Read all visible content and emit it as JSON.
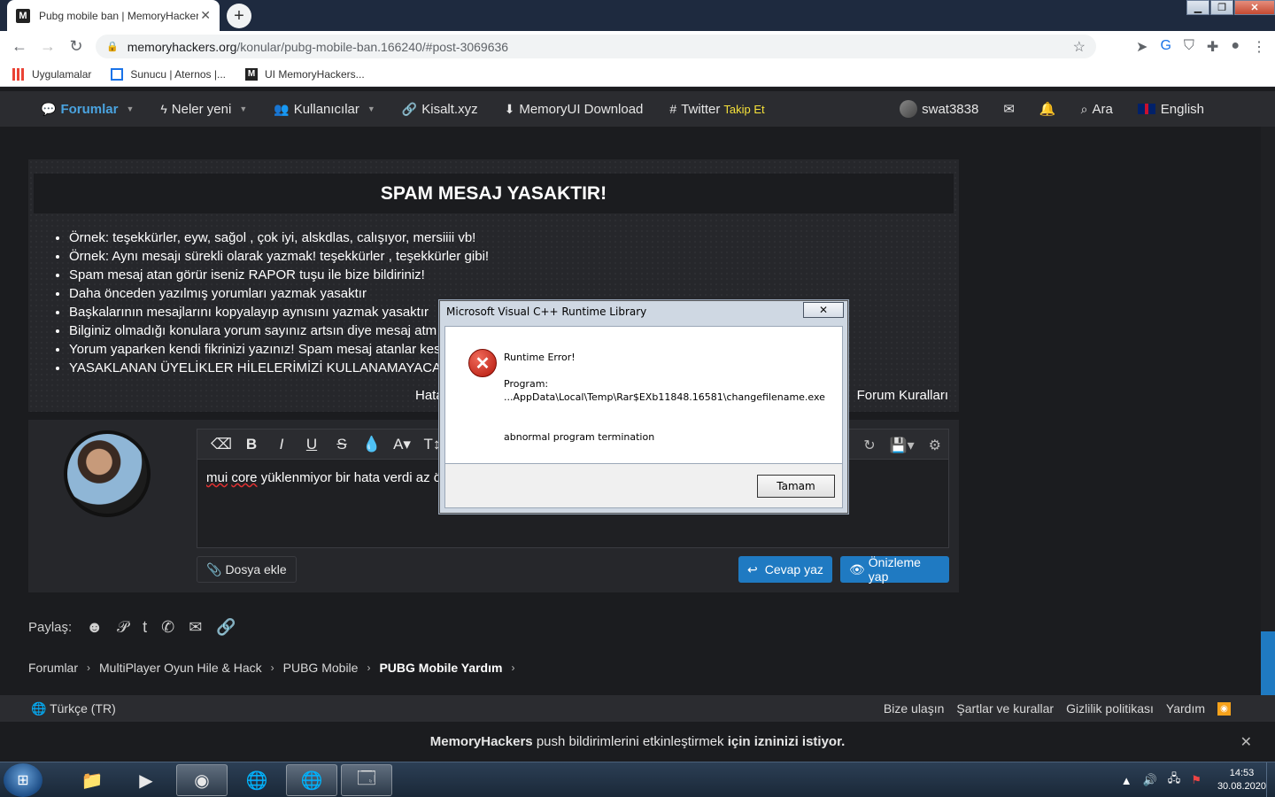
{
  "browser": {
    "tab_title": "Pubg mobile ban | MemoryHackers",
    "tab_favicon": "M",
    "url_host": "memoryhackers.org",
    "url_path": "/konular/pubg-mobile-ban.166240/#post-3069636",
    "bookmarks": [
      {
        "label": "Uygulamalar",
        "icon": "apps-grid-icon"
      },
      {
        "label": "Sunucu | Aternos |...",
        "icon": "aternos-icon"
      },
      {
        "label": "UI MemoryHackers...",
        "icon": "memoryhackers-icon"
      }
    ]
  },
  "nav": {
    "forums": "Forumlar",
    "whats_new": "Neler yeni",
    "members": "Kullanıcılar",
    "shortlink": "Kisalt.xyz",
    "download": "MemoryUI Download",
    "twitter": "Twitter",
    "twitter_follow": "Takip Et",
    "username": "swat3838",
    "search": "Ara",
    "language": "English"
  },
  "notice": {
    "title": "SPAM MESAJ YASAKTIR!",
    "rules": [
      "Örnek: teşekkürler, eyw, sağol , çok iyi, alskdlas, calışıyor, mersiiii vb!",
      "Örnek: Aynı mesajı sürekli olarak yazmak! teşekkürler , teşekkürler gibi!",
      "Spam mesaj atan görür iseniz RAPOR tuşu ile bize bildiriniz!",
      "Daha önceden yazılmış yorumları yazmak yasaktır",
      "Başkalarının mesajlarını kopyalayıp aynısını yazmak yasaktır",
      "Bilginiz olmadığı konulara yorum sayınız artsın diye mesaj atm",
      "Yorum yaparken kendi fikrinizi yazınız! Spam mesaj atanlar kes",
      "YASAKLANAN ÜYELİKLER HİLELERİMİZİ KULLANAMAYACA"
    ],
    "left_link": "Hata",
    "right_link": "Forum Kuralları"
  },
  "editor": {
    "text_spell": "mui",
    "text_spell2": "core",
    "text_rest": "yüklenmiyor bir hata verdi az ö",
    "attach_label": "Dosya ekle",
    "reply_label": "Cevap yaz",
    "preview_label": "Önizleme yap"
  },
  "share_label": "Paylaş:",
  "breadcrumb": [
    "Forumlar",
    "MultiPlayer Oyun Hile & Hack",
    "PUBG Mobile",
    "PUBG Mobile Yardım"
  ],
  "footer": {
    "language": "Türkçe (TR)",
    "links": [
      "Bize ulaşın",
      "Şartlar ve kurallar",
      "Gizlilik politikası",
      "Yardım"
    ]
  },
  "push_bar": {
    "brand": "MemoryHackers",
    "text1": "push bildirimlerini etkinleştirmek",
    "text_bold": "için izninizi istiyor."
  },
  "dialog": {
    "title": "Microsoft Visual C++ Runtime Library",
    "heading": "Runtime Error!",
    "program_label": "Program:",
    "program_path": "...AppData\\Local\\Temp\\Rar$EXb11848.16581\\changefilename.exe",
    "message": "abnormal program termination",
    "ok_label": "Tamam"
  },
  "taskbar": {
    "time": "14:53",
    "date": "30.08.2020"
  },
  "colors": {
    "accent_blue": "#1f7ac2",
    "nav_active": "#4aa3df",
    "twitter_follow": "#f5e13a",
    "page_bg": "#1b1c1f"
  }
}
